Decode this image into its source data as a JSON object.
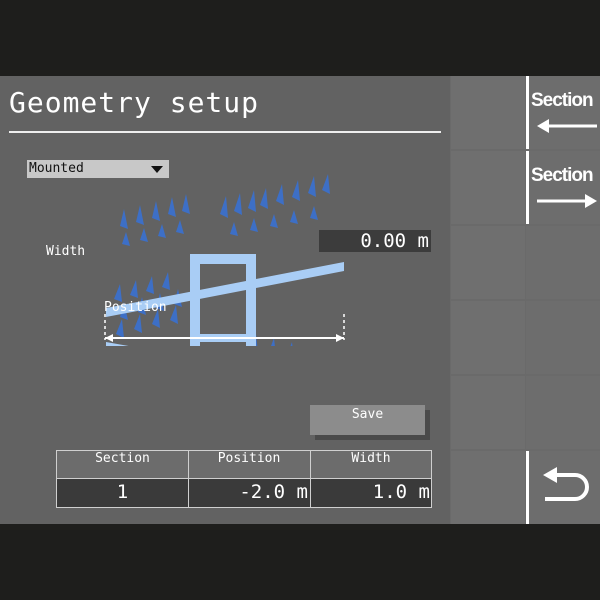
{
  "page": {
    "title": "Geometry setup"
  },
  "mount": {
    "selected": "Mounted"
  },
  "diagram": {
    "width_label": "Width",
    "position_label": "Position",
    "readout": "0.00 m"
  },
  "save_label": "Save",
  "table": {
    "headers": [
      "Section",
      "Position",
      "Width"
    ],
    "row": [
      "1",
      "-2.0 m",
      "1.0 m"
    ]
  },
  "softkeys": {
    "section_prev": {
      "label": "Section",
      "icon": "arrow-left-icon"
    },
    "section_next": {
      "label": "Section",
      "icon": "arrow-right-icon"
    },
    "back": {
      "icon": "return-icon"
    }
  },
  "colors": {
    "frame_blue": "#a9cdf5",
    "tine_blue": "#3d6fc6",
    "panel": "#626262",
    "button_grid": "#6f6f6f"
  }
}
